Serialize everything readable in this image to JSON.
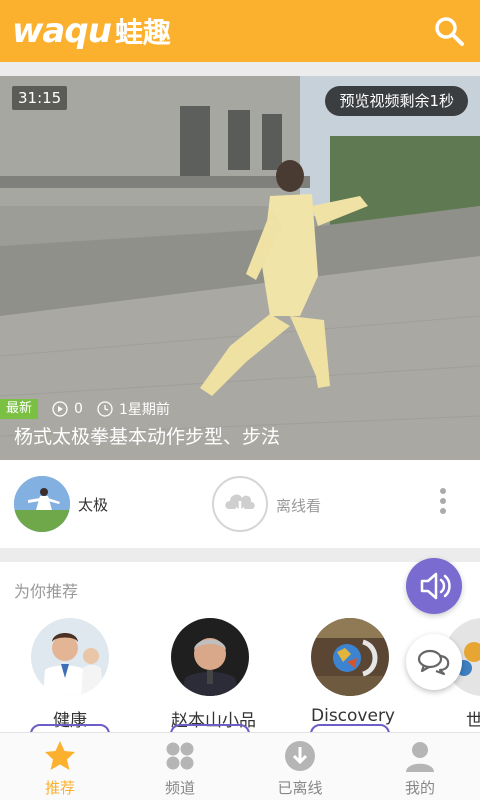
{
  "header": {
    "logo_latin": "waqu",
    "logo_cn": "蛙趣",
    "search_icon": "search-icon",
    "color": "#fbb12e"
  },
  "video": {
    "duration": "31:15",
    "preview_notice": "预览视频剩余1秒",
    "badge": "最新",
    "play_count": "0",
    "time_ago": "1星期前",
    "title": "杨式太极拳基本动作步型、步法"
  },
  "info": {
    "category": "太极",
    "offline_label": "离线看"
  },
  "recommend": {
    "title": "为你推荐",
    "items": [
      {
        "label": "健康"
      },
      {
        "label": "赵本山小品"
      },
      {
        "label": "Discovery"
      },
      {
        "label": "世界"
      }
    ]
  },
  "nav": {
    "items": [
      {
        "label": "推荐",
        "icon": "star-icon",
        "active": true
      },
      {
        "label": "频道",
        "icon": "grid-icon",
        "active": false
      },
      {
        "label": "已离线",
        "icon": "download-icon",
        "active": false
      },
      {
        "label": "我的",
        "icon": "user-icon",
        "active": false
      }
    ]
  },
  "colors": {
    "accent": "#fbb12e",
    "fab": "#7a6bd1",
    "badge": "#7ac143"
  }
}
